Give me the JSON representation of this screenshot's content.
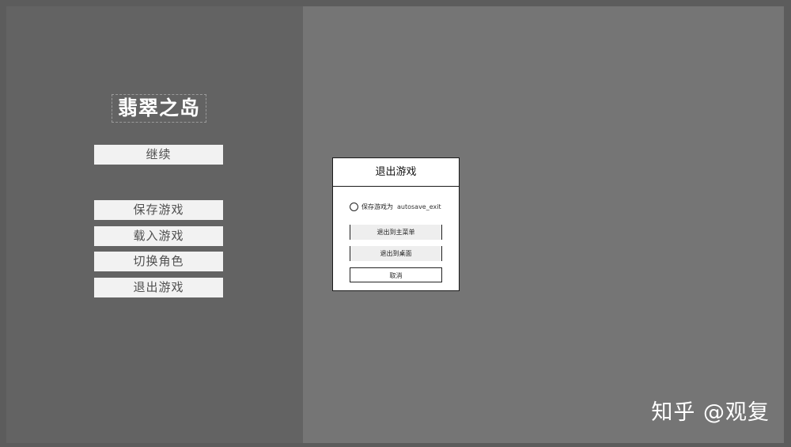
{
  "game": {
    "title": "翡翠之岛"
  },
  "menu": {
    "continue_label": "继续",
    "save_label": "保存游戏",
    "load_label": "载入游戏",
    "switch_label": "切换角色",
    "quit_label": "退出游戏"
  },
  "dialog": {
    "title": "退出游戏",
    "save_option_label": "保存游戏为",
    "save_filename": "autosave_exit",
    "save_checked": false,
    "exit_to_menu_label": "退出到主菜单",
    "exit_to_desktop_label": "退出到桌面",
    "cancel_label": "取消"
  },
  "watermark": {
    "text": "知乎 @观复"
  }
}
